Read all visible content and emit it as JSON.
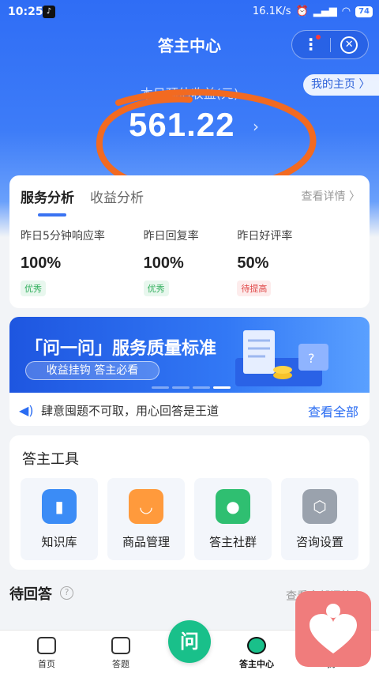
{
  "status_bar": {
    "time": "10:25",
    "net_speed": "16.1K/s",
    "battery": "74"
  },
  "nav": {
    "title": "答主中心"
  },
  "home_button": {
    "label": "我的主页 〉"
  },
  "earnings": {
    "label": "本日预估收益(元)",
    "value": "561.22"
  },
  "analysis": {
    "tab_active": "服务分析",
    "tab_other": "收益分析",
    "more": "查看详情 〉",
    "metrics": [
      {
        "label": "昨日5分钟响应率",
        "value": "100%",
        "badge": "优秀"
      },
      {
        "label": "昨日回复率",
        "value": "100%",
        "badge": "优秀"
      },
      {
        "label": "昨日好评率",
        "value": "50%",
        "badge": "待提高"
      }
    ]
  },
  "banner": {
    "title": "「问一问」服务质量标准",
    "subtitle": "收益挂钩 答主必看"
  },
  "notice": {
    "text": "肆意囤题不可取，用心回答是王道",
    "link": "查看全部"
  },
  "tools": {
    "title": "答主工具",
    "items": [
      {
        "label": "知识库",
        "icon": "book-icon",
        "color": "#3b8cf6"
      },
      {
        "label": "商品管理",
        "icon": "shopping-bag-icon",
        "color": "#ff9a3c"
      },
      {
        "label": "答主社群",
        "icon": "community-icon",
        "color": "#2fbf71"
      },
      {
        "label": "咨询设置",
        "icon": "settings-hex-icon",
        "color": "#9aa2ad"
      }
    ]
  },
  "pending": {
    "title": "待回答",
    "more": "查看全部问答 〉"
  },
  "tabbar": {
    "items": [
      {
        "label": "首页"
      },
      {
        "label": "答题"
      },
      {
        "label": "问"
      },
      {
        "label": "答主中心"
      },
      {
        "label": "我"
      }
    ]
  }
}
